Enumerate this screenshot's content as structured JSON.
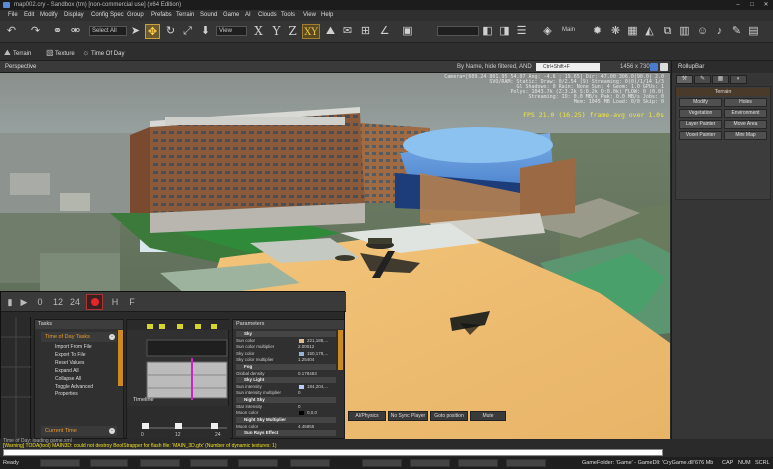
{
  "window": {
    "title": "map002.cry - Sandbox (tm) [non-commercial use] (x64 Edition)",
    "minimize": "–",
    "maximize": "□",
    "close": "✕"
  },
  "menu": [
    "File",
    "Edit",
    "Modify",
    "Display",
    "Config Spec",
    "Group",
    "Prefabs",
    "Terrain",
    "Sound",
    "Game",
    "AI",
    "Clouds",
    "Tools",
    "View",
    "Help"
  ],
  "toolbar": {
    "select_filter": "Select All",
    "view_mode": "View",
    "axes": [
      "X",
      "Y",
      "Z",
      "XY"
    ],
    "layer_select": "Main"
  },
  "toolbar2": {
    "items": [
      "Terrain",
      "Texture",
      "Time Of Day"
    ]
  },
  "viewport": {
    "label": "Perspective",
    "filter_label": "By Name, hide filtered, AND",
    "search_placeholder": "Ctrl+Shift+F",
    "resolution": "1456 x 730",
    "debug_lines": [
      "Camera=[609.24 801.95 54.07 Ang: -4.6  : 19.65]  Dir: 47.00 306.0(90.0) 2.0",
      "SVO/RAM: Static: Draw: 0/2.54 (9) Streaming: 0(0)/1/14 1/3",
      "Gl Shadows: 0 Rain: None Sun: 4 Geom: 1.0 GPUs: 1",
      "Polys: 1043.7k (Z:3.2k  S:0.2k  O:0.0k)  FLOW: 0  (0.0)",
      "Streaming: IO: 0.0 MB/s  Pak: 0.0 MB/s  Jobs: 0",
      "Mem: 1045 MB  Load: 0/0  Skip: 0"
    ],
    "fps_line": "FPS 21.0 (16.25)  frame-avg over 1.0s"
  },
  "rollup": {
    "title": "RollupBar",
    "tabs": [
      "⚒",
      "✎",
      "▦",
      "◐"
    ],
    "panel_title": "Terrain",
    "buttons": [
      "Modify",
      "Holes",
      "Vegetation",
      "Environment",
      "Layer Painter",
      "Move Area",
      "Voxel Painter",
      "Mini Map"
    ]
  },
  "trackview": {
    "toolbar_labels": [
      "0",
      "12",
      "24",
      "H",
      "F"
    ],
    "tasks": {
      "title": "Tasks",
      "group1": "Time of Day Tasks",
      "items": [
        "Import From File",
        "Export To File",
        "Reset Values",
        "Expand All",
        "Collapse All",
        "Toggle Advanced Properties"
      ],
      "group2": "Current Time"
    },
    "timeline": {
      "label": "Timeline",
      "ticks": [
        "0",
        "12",
        "24"
      ]
    },
    "params": {
      "title": "Parameters",
      "rows": [
        {
          "type": "group",
          "label": "Sky"
        },
        {
          "type": "row",
          "label": "Sun color",
          "value": "221,188,...",
          "color": "#ddbc8c"
        },
        {
          "type": "row",
          "label": "Sun color multiplier",
          "value": "2.00012"
        },
        {
          "type": "row",
          "label": "Sky color",
          "value": "150,178,...",
          "color": "#96b2d8"
        },
        {
          "type": "row",
          "label": "Sky color multiplier",
          "value": "1.25404"
        },
        {
          "type": "group",
          "label": "Fog"
        },
        {
          "type": "row",
          "label": "Global density",
          "value": "0.178483"
        },
        {
          "type": "group",
          "label": "Sky Light"
        },
        {
          "type": "row",
          "label": "Sun intensity",
          "value": "184,204,...",
          "color": "#b8ccff"
        },
        {
          "type": "row",
          "label": "Sun intensity multiplier",
          "value": "0"
        },
        {
          "type": "group",
          "label": "Night Sky"
        },
        {
          "type": "row",
          "label": "Star intensity",
          "value": "0"
        },
        {
          "type": "row",
          "label": "Moon color",
          "value": "0,0,0",
          "color": "#000000"
        },
        {
          "type": "group",
          "label": "Night Sky Multiplier"
        },
        {
          "type": "row",
          "label": "Moon color",
          "value": "4.46855"
        },
        {
          "type": "group",
          "label": "Sun Rays Effect"
        }
      ]
    }
  },
  "console_buttons": [
    "AI/Physics",
    "No Sync Player",
    "Goto position",
    "Mute"
  ],
  "console": {
    "line1": "Time of Day: loading game.xml",
    "line2": "[Warning] TODA(tool) MAIN3D: could not destroy BoolStrapper for flash file: 'MAIN_3D.gfx' (Number of dynamic textures: 1)"
  },
  "status": {
    "ready": "Ready",
    "game_folder": "GameFolder: 'Game' - GameDll: 'CryGame.dll'",
    "memory": "676 Mb",
    "caps": "CAP",
    "num": "NUM",
    "scrl": "SCRL"
  },
  "colors": {
    "accent": "#c9a23b",
    "warning_text": "#f0e020",
    "fps": "#f0e63a",
    "record": "#e2262b",
    "slider_orange": "#cc8a20"
  }
}
